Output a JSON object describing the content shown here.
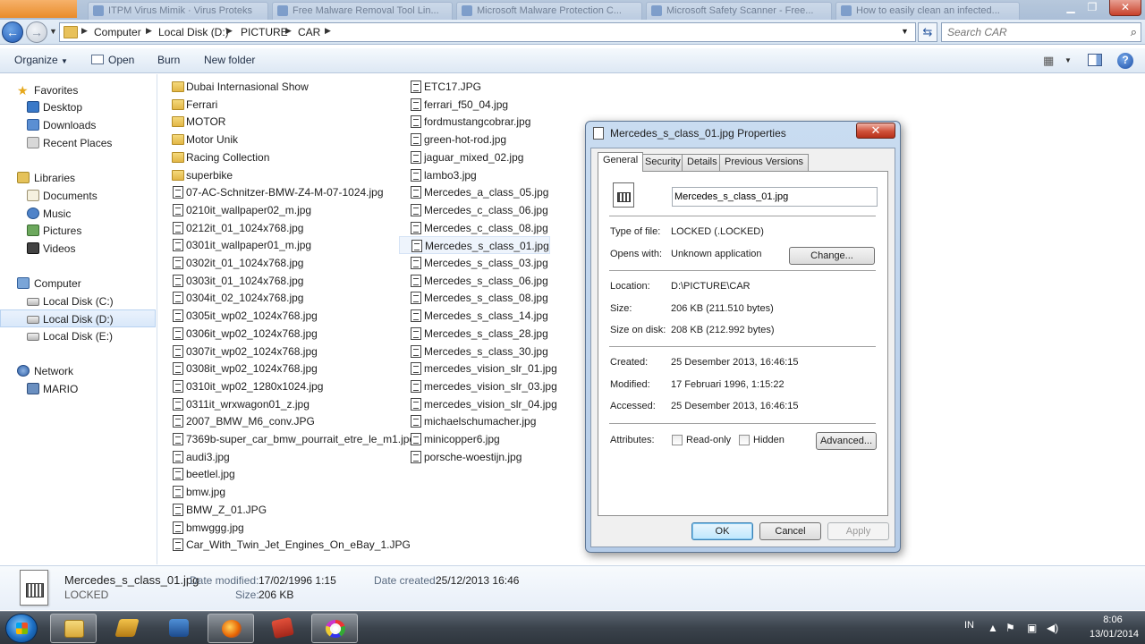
{
  "browser_tabs": [
    "ITPM Virus Mimik · Virus Proteks",
    "Free Malware Removal Tool Lin...",
    "Microsoft Malware Protection C...",
    "Microsoft Safety Scanner - Free...",
    "How to easily clean an infected..."
  ],
  "address": {
    "crumbs": [
      "Computer",
      "Local Disk (D:)",
      "PICTURE",
      "CAR"
    ]
  },
  "search": {
    "placeholder": "Search CAR"
  },
  "toolbar": {
    "organize": "Organize",
    "open": "Open",
    "burn": "Burn",
    "new_folder": "New folder"
  },
  "nav": {
    "favorites": "Favorites",
    "desktop": "Desktop",
    "downloads": "Downloads",
    "recent": "Recent Places",
    "libraries": "Libraries",
    "documents": "Documents",
    "music": "Music",
    "pictures": "Pictures",
    "videos": "Videos",
    "computer": "Computer",
    "disk_c": "Local Disk (C:)",
    "disk_d": "Local Disk (D:)",
    "disk_e": "Local Disk (E:)",
    "network": "Network",
    "mario": "MARIO"
  },
  "files": {
    "col1": [
      {
        "name": "Dubai Internasional Show",
        "type": "folder"
      },
      {
        "name": "Ferrari",
        "type": "folder"
      },
      {
        "name": "MOTOR",
        "type": "folder"
      },
      {
        "name": "Motor Unik",
        "type": "folder"
      },
      {
        "name": "Racing Collection",
        "type": "folder"
      },
      {
        "name": "superbike",
        "type": "folder"
      },
      {
        "name": "07-AC-Schnitzer-BMW-Z4-M-07-1024.jpg",
        "type": "file"
      },
      {
        "name": "0210it_wallpaper02_m.jpg",
        "type": "file"
      },
      {
        "name": "0212it_01_1024x768.jpg",
        "type": "file"
      },
      {
        "name": "0301it_wallpaper01_m.jpg",
        "type": "file"
      },
      {
        "name": "0302it_01_1024x768.jpg",
        "type": "file"
      },
      {
        "name": "0303it_01_1024x768.jpg",
        "type": "file"
      },
      {
        "name": "0304it_02_1024x768.jpg",
        "type": "file"
      },
      {
        "name": "0305it_wp02_1024x768.jpg",
        "type": "file"
      },
      {
        "name": "0306it_wp02_1024x768.jpg",
        "type": "file"
      },
      {
        "name": "0307it_wp02_1024x768.jpg",
        "type": "file"
      },
      {
        "name": "0308it_wp02_1024x768.jpg",
        "type": "file"
      },
      {
        "name": "0310it_wp02_1280x1024.jpg",
        "type": "file"
      },
      {
        "name": "0311it_wrxwagon01_z.jpg",
        "type": "file"
      },
      {
        "name": "2007_BMW_M6_conv.JPG",
        "type": "file"
      },
      {
        "name": "7369b-super_car_bmw_pourrait_etre_le_m1.jpg",
        "type": "file"
      },
      {
        "name": "audi3.jpg",
        "type": "file"
      },
      {
        "name": "beetlel.jpg",
        "type": "file"
      },
      {
        "name": "bmw.jpg",
        "type": "file"
      },
      {
        "name": "BMW_Z_01.JPG",
        "type": "file"
      },
      {
        "name": "bmwggg.jpg",
        "type": "file"
      },
      {
        "name": "Car_With_Twin_Jet_Engines_On_eBay_1.JPG",
        "type": "file"
      }
    ],
    "col2": [
      {
        "name": "ETC17.JPG",
        "type": "file"
      },
      {
        "name": "ferrari_f50_04.jpg",
        "type": "file"
      },
      {
        "name": "fordmustangcobrar.jpg",
        "type": "file"
      },
      {
        "name": "green-hot-rod.jpg",
        "type": "file"
      },
      {
        "name": "jaguar_mixed_02.jpg",
        "type": "file"
      },
      {
        "name": "lambo3.jpg",
        "type": "file"
      },
      {
        "name": "Mercedes_a_class_05.jpg",
        "type": "file"
      },
      {
        "name": "Mercedes_c_class_06.jpg",
        "type": "file"
      },
      {
        "name": "Mercedes_c_class_08.jpg",
        "type": "file"
      },
      {
        "name": "Mercedes_s_class_01.jpg",
        "type": "file"
      },
      {
        "name": "Mercedes_s_class_03.jpg",
        "type": "file"
      },
      {
        "name": "Mercedes_s_class_06.jpg",
        "type": "file"
      },
      {
        "name": "Mercedes_s_class_08.jpg",
        "type": "file"
      },
      {
        "name": "Mercedes_s_class_14.jpg",
        "type": "file"
      },
      {
        "name": "Mercedes_s_class_28.jpg",
        "type": "file"
      },
      {
        "name": "Mercedes_s_class_30.jpg",
        "type": "file"
      },
      {
        "name": "mercedes_vision_slr_01.jpg",
        "type": "file"
      },
      {
        "name": "mercedes_vision_slr_03.jpg",
        "type": "file"
      },
      {
        "name": "mercedes_vision_slr_04.jpg",
        "type": "file"
      },
      {
        "name": "michaelschumacher.jpg",
        "type": "file"
      },
      {
        "name": "minicopper6.jpg",
        "type": "file"
      },
      {
        "name": "porsche-woestijn.jpg",
        "type": "file"
      }
    ]
  },
  "details": {
    "name": "Mercedes_s_class_01.jpg",
    "type": "LOCKED",
    "modified_label": "Date modified:",
    "modified_value": "17/02/1996 1:15",
    "created_label": "Date created:",
    "created_value": "25/12/2013 16:46",
    "size_label": "Size:",
    "size_value": "206 KB"
  },
  "dialog": {
    "title": "Mercedes_s_class_01.jpg Properties",
    "close": "✕",
    "tabs": [
      "General",
      "Security",
      "Details",
      "Previous Versions"
    ],
    "filename": "Mercedes_s_class_01.jpg",
    "type_label": "Type of file:",
    "type_value": "LOCKED (.LOCKED)",
    "opens_label": "Opens with:",
    "opens_value": "Unknown application",
    "change_btn": "Change...",
    "location_label": "Location:",
    "location_value": "D:\\PICTURE\\CAR",
    "size_label": "Size:",
    "size_value": "206 KB (211.510 bytes)",
    "disk_label": "Size on disk:",
    "disk_value": "208 KB (212.992 bytes)",
    "created_label": "Created:",
    "created_value": "25 Desember 2013, 16:46:15",
    "modified_label": "Modified:",
    "modified_value": "17 Februari 1996, 1:15:22",
    "accessed_label": "Accessed:",
    "accessed_value": "25 Desember 2013, 16:46:15",
    "attributes_label": "Attributes:",
    "readonly_label": "Read-only",
    "hidden_label": "Hidden",
    "advanced_btn": "Advanced...",
    "ok_btn": "OK",
    "cancel_btn": "Cancel",
    "apply_btn": "Apply"
  },
  "taskbar": {
    "language": "IN",
    "time": "8:06",
    "date": "13/01/2014"
  }
}
